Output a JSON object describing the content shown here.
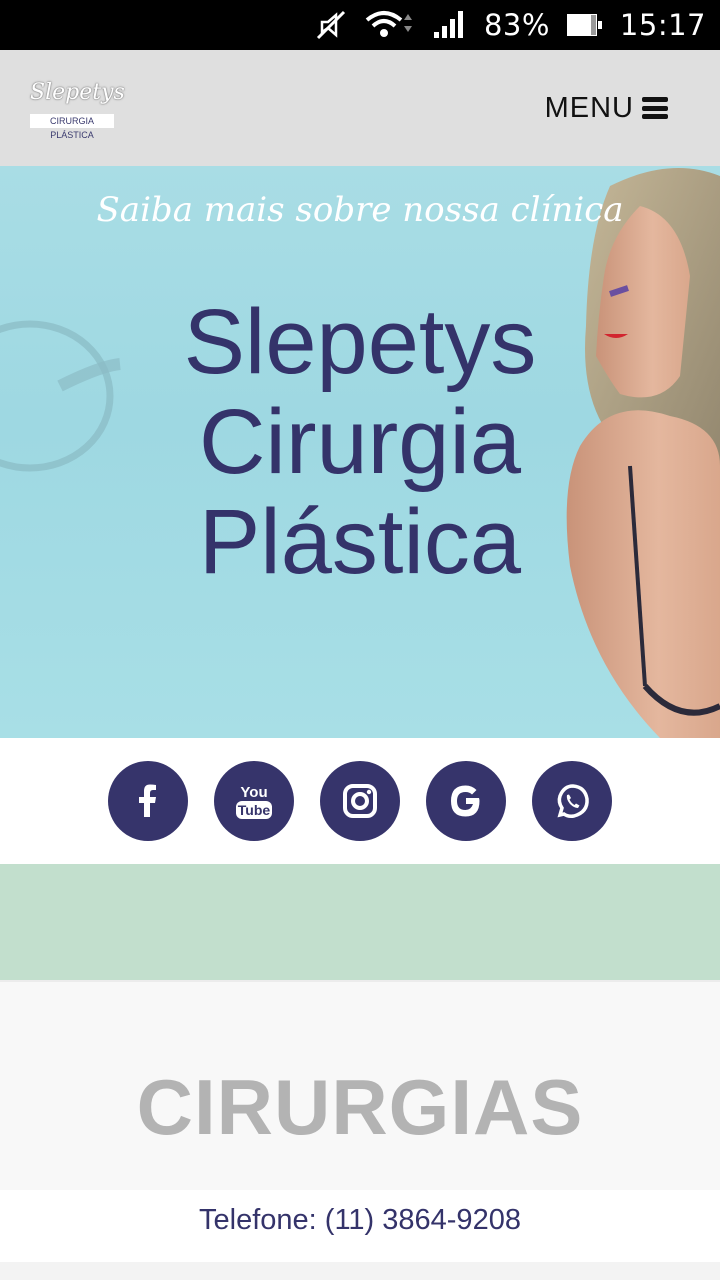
{
  "status_bar": {
    "battery_percent": "83%",
    "time": "15:17",
    "icons": [
      "mute-icon",
      "wifi-icon",
      "signal-icon",
      "battery-icon"
    ]
  },
  "header": {
    "logo_script": "Slepetys",
    "logo_subtitle": "CIRURGIA PLÁSTICA",
    "menu_label": "MENU",
    "menu_icon": "hamburger-icon",
    "background": "#dfdfdf"
  },
  "hero": {
    "tagline": "Saiba mais sobre nossa clínica",
    "title_lines": [
      "Slepetys",
      "Cirurgia",
      "Plástica"
    ],
    "title_color": "#34336a"
  },
  "social": {
    "color": "#36346b",
    "links": [
      {
        "icon": "facebook-icon",
        "label": "f"
      },
      {
        "icon": "youtube-icon",
        "label": "You Tube"
      },
      {
        "icon": "instagram-icon"
      },
      {
        "icon": "google-icon",
        "label": "G"
      },
      {
        "icon": "whatsapp-icon"
      }
    ]
  },
  "section": {
    "title": "CIRURGIAS"
  },
  "footer": {
    "phone": "Telefone: (11) 3864-9208"
  },
  "colors": {
    "accent": "#34336a",
    "mint": "#c2dfcd",
    "hero_bg": "#a3dbe4"
  }
}
